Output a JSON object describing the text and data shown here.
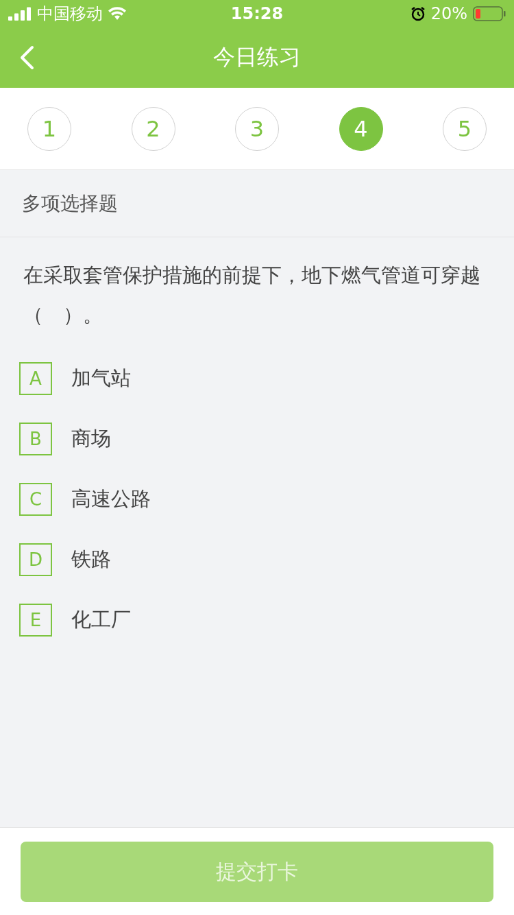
{
  "status_bar": {
    "carrier": "中国移动",
    "time": "15:28",
    "battery": "20%"
  },
  "header": {
    "title": "今日练习"
  },
  "steps": [
    {
      "label": "1",
      "selected": false
    },
    {
      "label": "2",
      "selected": false
    },
    {
      "label": "3",
      "selected": false
    },
    {
      "label": "4",
      "selected": true
    },
    {
      "label": "5",
      "selected": false
    }
  ],
  "section": {
    "title": "多项选择题"
  },
  "question": "在采取套管保护措施的前提下，地下燃气管道可穿越（　）。",
  "options": [
    {
      "letter": "A",
      "text": "加气站",
      "selected": false
    },
    {
      "letter": "B",
      "text": "商场",
      "selected": false
    },
    {
      "letter": "C",
      "text": "高速公路",
      "selected": false
    },
    {
      "letter": "D",
      "text": "铁路",
      "selected": false
    },
    {
      "letter": "E",
      "text": "化工厂",
      "selected": false
    }
  ],
  "submit": {
    "label": "提交打卡",
    "disabled": true
  }
}
